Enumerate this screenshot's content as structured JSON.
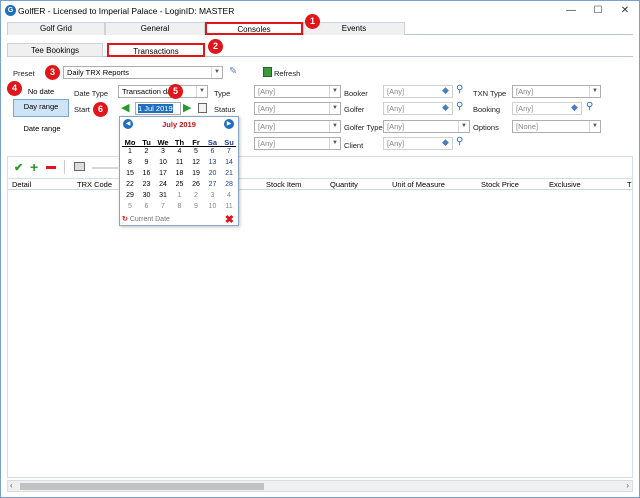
{
  "window": {
    "title": "GolfER - Licensed to Imperial Palace - LoginID: MASTER",
    "minimize": "—",
    "maximize": "☐",
    "close": "✕"
  },
  "tabs": [
    "Golf Grid",
    "General",
    "Consoles",
    "Events"
  ],
  "subtabs": [
    "Tee Bookings",
    "Transactions"
  ],
  "badges": [
    "1",
    "2",
    "3",
    "4",
    "5",
    "6"
  ],
  "preset": {
    "label": "Preset",
    "value": "Daily TRX Reports",
    "refresh": "Refresh"
  },
  "side": {
    "no_date": "No date",
    "day_range": "Day range",
    "date_range": "Date range"
  },
  "filters": {
    "date_type_label": "Date Type",
    "date_type_value": "Transaction date",
    "start_label": "Start",
    "start_value": "1 Jul 2019",
    "type_label": "Type",
    "type_value": "[Any]",
    "status_label": "Status",
    "status_value": "[Any]",
    "row3_value": "[Any]",
    "row4_value": "[Any]",
    "booker_label": "Booker",
    "booker_value": "[Any]",
    "golfer_label": "Golfer",
    "golfer_value": "[Any]",
    "golfer_type_label": "Golfer Type",
    "golfer_type_value": "[Any]",
    "client_label": "Client",
    "client_value": "[Any]",
    "txn_type_label": "TXN Type",
    "txn_type_value": "[Any]",
    "booking_label": "Booking",
    "booking_value": "[Any]",
    "options_label": "Options",
    "options_value": "[None]"
  },
  "grid": {
    "columns": [
      "Detail",
      "TRX Code",
      "Stock Item",
      "Quantity",
      "Unit of Measure",
      "Stock Price",
      "Exclusive",
      "T"
    ]
  },
  "calendar": {
    "month": "July 2019",
    "dow": [
      "Mo",
      "Tu",
      "We",
      "Th",
      "Fr",
      "Sa",
      "Su"
    ],
    "weeks": [
      [
        "1",
        "2",
        "3",
        "4",
        "5",
        "6",
        "7"
      ],
      [
        "8",
        "9",
        "10",
        "11",
        "12",
        "13",
        "14"
      ],
      [
        "15",
        "16",
        "17",
        "18",
        "19",
        "20",
        "21"
      ],
      [
        "22",
        "23",
        "24",
        "25",
        "26",
        "27",
        "28"
      ],
      [
        "29",
        "30",
        "31",
        "1",
        "2",
        "3",
        "4"
      ],
      [
        "5",
        "6",
        "7",
        "8",
        "9",
        "10",
        "11"
      ]
    ],
    "current_date": "Current Date"
  },
  "colors": {
    "accent": "#e0161b",
    "brand": "#1e6fbf"
  }
}
